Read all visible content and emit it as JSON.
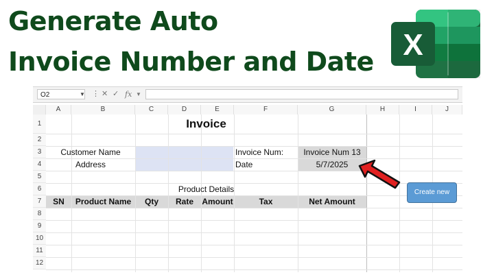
{
  "headline": {
    "line1": "Generate Auto",
    "line2": "Invoice Number and Date"
  },
  "logo": {
    "letter": "X",
    "icon": "excel-icon",
    "color": "#1d6f42"
  },
  "formula_bar": {
    "name_box": "O2",
    "fx": "fx",
    "cancel": "✕",
    "confirm": "✓",
    "value": ""
  },
  "columns": [
    "A",
    "B",
    "C",
    "D",
    "E",
    "F",
    "G",
    "H",
    "I",
    "J"
  ],
  "rows": [
    "1",
    "2",
    "3",
    "4",
    "5",
    "6",
    "7",
    "8",
    "9",
    "10",
    "11",
    "12"
  ],
  "invoice": {
    "title": "Invoice",
    "customer_name_label": "Customer Name",
    "address_label": "Address",
    "invoice_num_label": "Invoice Num:",
    "invoice_num_value": "Invoice Num 13",
    "date_label": "Date",
    "date_value": "5/7/2025",
    "product_details_label": "Product Details",
    "table_headers": [
      "SN",
      "Product Name",
      "Qty",
      "Rate",
      "Amount",
      "Tax",
      "Net Amount"
    ]
  },
  "button": {
    "label": "Create new"
  },
  "colors": {
    "title_green": "#0f4a1c",
    "fill_blue": "#dde3f4",
    "fill_gray": "#d9d9d9",
    "button_blue": "#5b9bd5",
    "arrow_red": "#e02020"
  }
}
